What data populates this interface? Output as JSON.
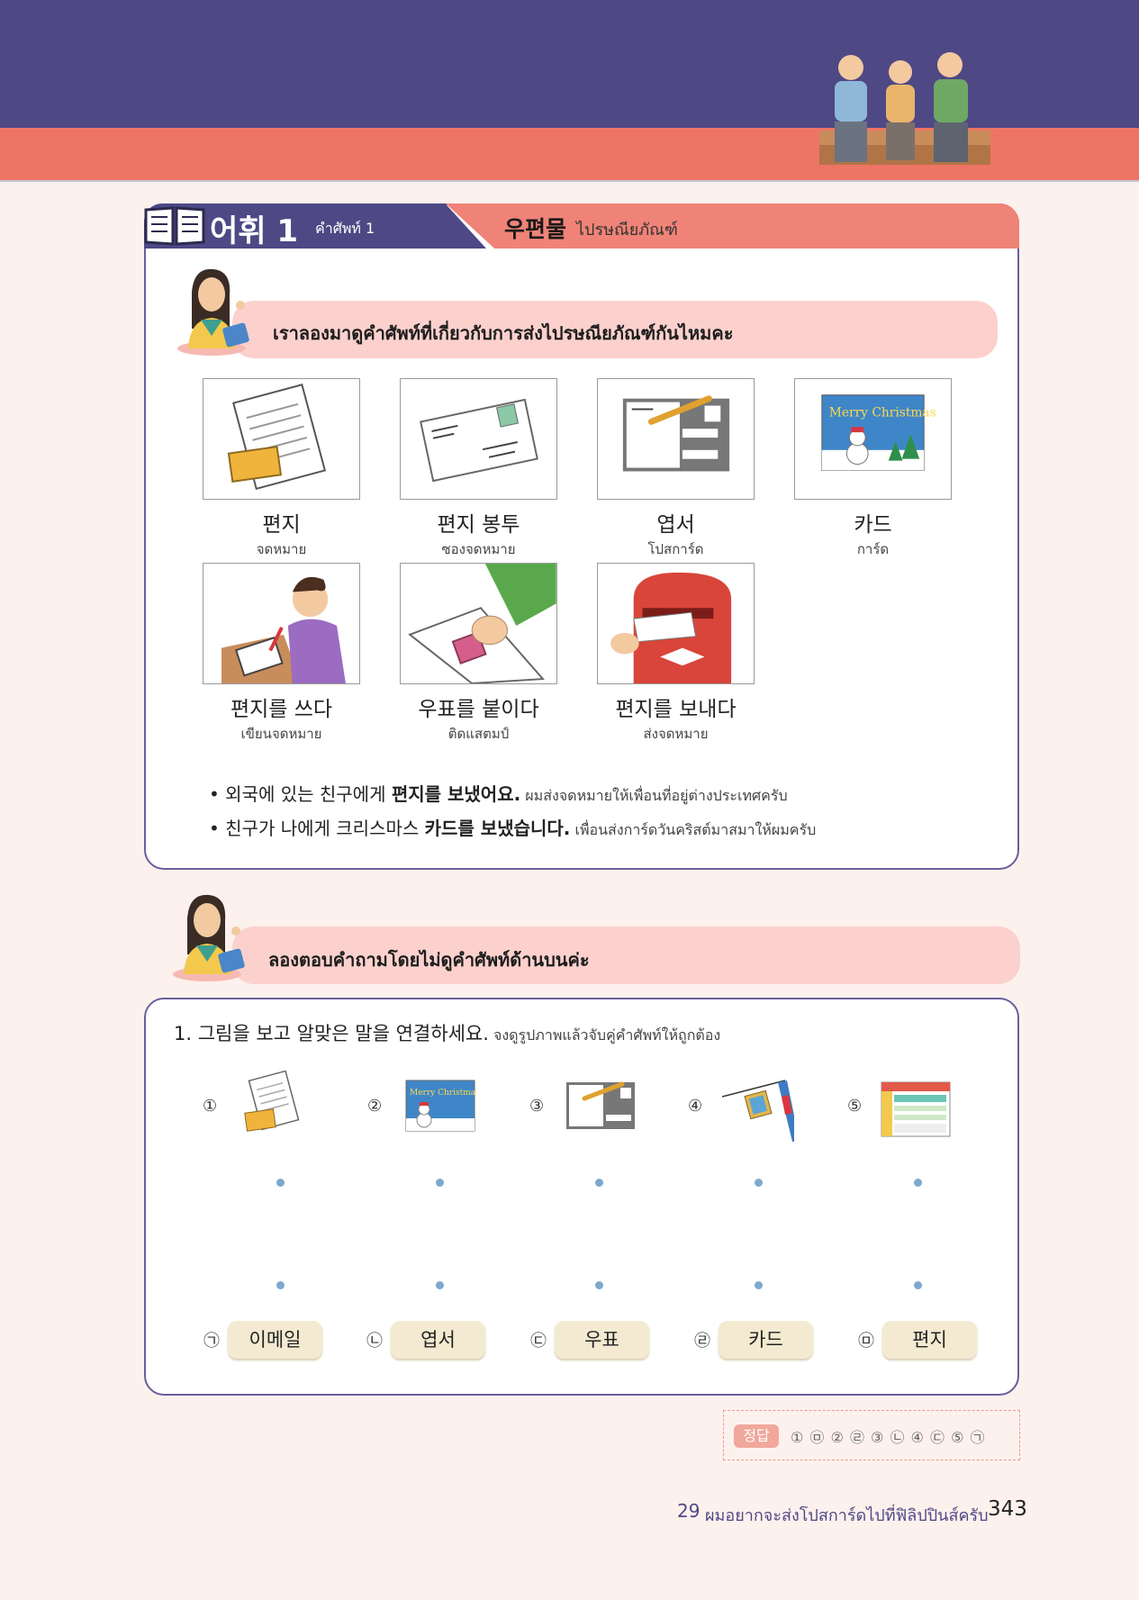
{
  "header": {
    "section_label": "어휘 1",
    "section_sub": "คำศัพท์ 1",
    "topic_kr": "우편물",
    "topic_th": "ไปรษณียภัณฑ์"
  },
  "intro_prompt": "เราลองมาดูคำศัพท์ที่เกี่ยวกับการส่งไปรษณียภัณฑ์กันไหมคะ",
  "vocab": [
    {
      "kr": "편지",
      "th": "จดหมาย",
      "icon": "letter"
    },
    {
      "kr": "편지 봉투",
      "th": "ซองจดหมาย",
      "icon": "envelope"
    },
    {
      "kr": "엽서",
      "th": "โปสการ์ด",
      "icon": "postcard"
    },
    {
      "kr": "카드",
      "th": "การ์ด",
      "icon": "christmas-card"
    },
    {
      "kr": "편지를 쓰다",
      "th": "เขียนจดหมาย",
      "icon": "writing-letter"
    },
    {
      "kr": "우표를 붙이다",
      "th": "ติดแสตมป์",
      "icon": "stamp"
    },
    {
      "kr": "편지를 보내다",
      "th": "ส่งจดหมาย",
      "icon": "mailbox"
    }
  ],
  "examples": [
    {
      "bullet": "•",
      "pre": "외국에 있는 친구에게 ",
      "bold": "편지를 보냈어요.",
      "th": " ผมส่งจดหมายให้เพื่อนที่อยู่ต่างประเทศครับ"
    },
    {
      "bullet": "•",
      "pre": "친구가 나에게 크리스마스 ",
      "bold": "카드를 보냈습니다.",
      "th": " เพื่อนส่งการ์ดวันคริสต์มาสมาให้ผมครับ"
    }
  ],
  "practice_prompt": "ลองตอบคำถามโดยไม่ดูคำศัพท์ด้านบนค่ะ",
  "exercise": {
    "title": "1. 그림을 보고 알맞은 말을 연결하세요.",
    "title_th": " จงดูรูปภาพแล้วจับคู่คำศัพท์ให้ถูกต้อง",
    "items": [
      {
        "num": "①",
        "icon": "letter"
      },
      {
        "num": "②",
        "icon": "christmas-card"
      },
      {
        "num": "③",
        "icon": "postcard"
      },
      {
        "num": "④",
        "icon": "stamp-flag"
      },
      {
        "num": "⑤",
        "icon": "email-window"
      }
    ],
    "options": [
      {
        "mark": "㉠",
        "label": "이메일"
      },
      {
        "mark": "㉡",
        "label": "엽서"
      },
      {
        "mark": "㉢",
        "label": "우표"
      },
      {
        "mark": "㉣",
        "label": "카드"
      },
      {
        "mark": "㉤",
        "label": "편지"
      }
    ]
  },
  "answer": {
    "label": "정답",
    "text": "① ㉤  ② ㉣  ③ ㉡  ④ ㉢  ⑤ ㉠"
  },
  "footer": {
    "lesson_num": "29",
    "lesson_title": "ผมอยากจะส่งโปสการ์ดไปที่ฟิลิปปินส์ครับ",
    "page": "343"
  },
  "colors": {
    "header_purple": "#4e4885",
    "header_coral": "#ee7565",
    "pill_pink": "#fcd1cd",
    "dot_blue": "#7da8cf"
  }
}
